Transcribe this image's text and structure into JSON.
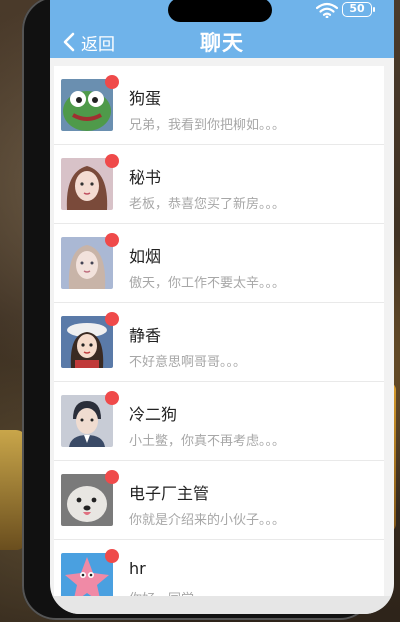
{
  "status_bar": {
    "battery": "50",
    "wifi_icon": "wifi-icon"
  },
  "header": {
    "back_label": "返回",
    "title": "聊天",
    "color": "#6fb3ea"
  },
  "chats": [
    {
      "name": "狗蛋",
      "preview": "兄弟，我看到你把柳如。。。",
      "unread": true,
      "avatar_color": "#4f9a4a"
    },
    {
      "name": "秘书",
      "preview": "老板，恭喜您买了新房。。。",
      "unread": true,
      "avatar_color": "#e8c8c0"
    },
    {
      "name": "如烟",
      "preview": "傲天，你工作不要太辛。。。",
      "unread": true,
      "avatar_color": "#a8b4cf"
    },
    {
      "name": "静香",
      "preview": "不好意思啊哥哥。。。",
      "unread": true,
      "avatar_color": "#5a7aa8"
    },
    {
      "name": "冷二狗",
      "preview": "小土鳖，你真不再考虑。。。",
      "unread": true,
      "avatar_color": "#3a4a66"
    },
    {
      "name": "电子厂主管",
      "preview": "你就是介绍来的小伙子。。。",
      "unread": true,
      "avatar_color": "#9a9a9a"
    },
    {
      "name": "hr",
      "preview": "你好，同学",
      "unread": true,
      "avatar_color": "#4aa0e0"
    }
  ]
}
